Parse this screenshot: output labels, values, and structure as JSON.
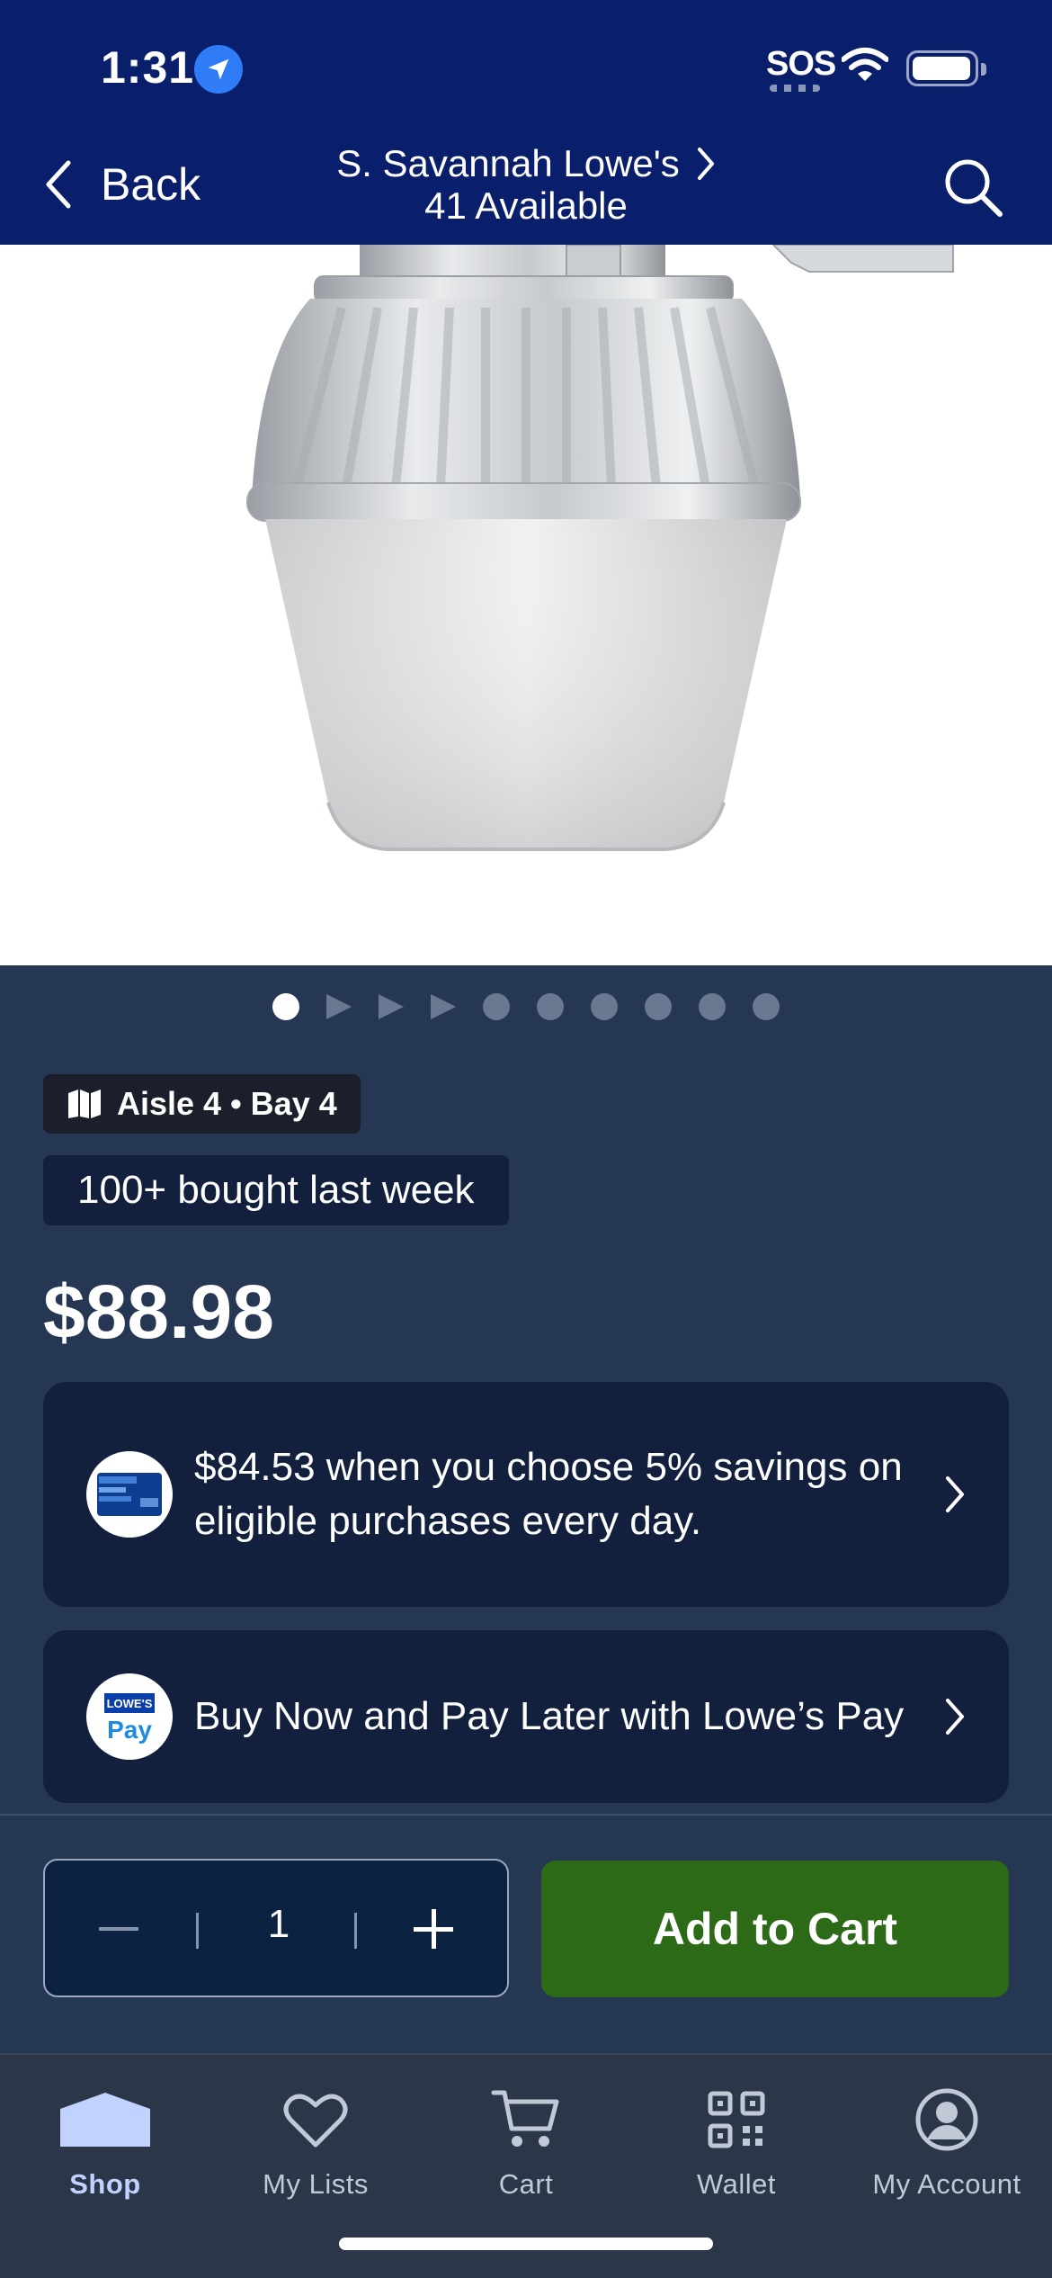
{
  "status_bar": {
    "time": "1:31",
    "sos": "SOS"
  },
  "header": {
    "back_label": "Back",
    "store_name": "S. Savannah Lowe's",
    "availability": "41 Available"
  },
  "gallery": {
    "total_items": 10,
    "active_index": 0
  },
  "location": {
    "aisle": "Aisle 4 • Bay 4"
  },
  "social_proof": "100+ bought last week",
  "price": "$88.98",
  "promos": [
    {
      "text": "$84.53 when you choose 5% savings on eligible purchases every day."
    },
    {
      "text": "Buy Now and Pay Later with Lowe’s Pay"
    }
  ],
  "pay_logo": {
    "top": "LOWE'S",
    "bottom": "Pay"
  },
  "quantity": {
    "value": "1"
  },
  "add_to_cart_label": "Add to Cart",
  "tabs": [
    {
      "label": "Shop",
      "icon": "shop-icon",
      "active": true
    },
    {
      "label": "My Lists",
      "icon": "heart-icon",
      "active": false
    },
    {
      "label": "Cart",
      "icon": "cart-icon",
      "active": false
    },
    {
      "label": "Wallet",
      "icon": "qr-code-icon",
      "active": false
    },
    {
      "label": "My Account",
      "icon": "account-icon",
      "active": false
    }
  ],
  "colors": {
    "header": "#0a1f6b",
    "background": "#263753",
    "card": "#12203e",
    "add_to_cart": "#2d6a17"
  }
}
